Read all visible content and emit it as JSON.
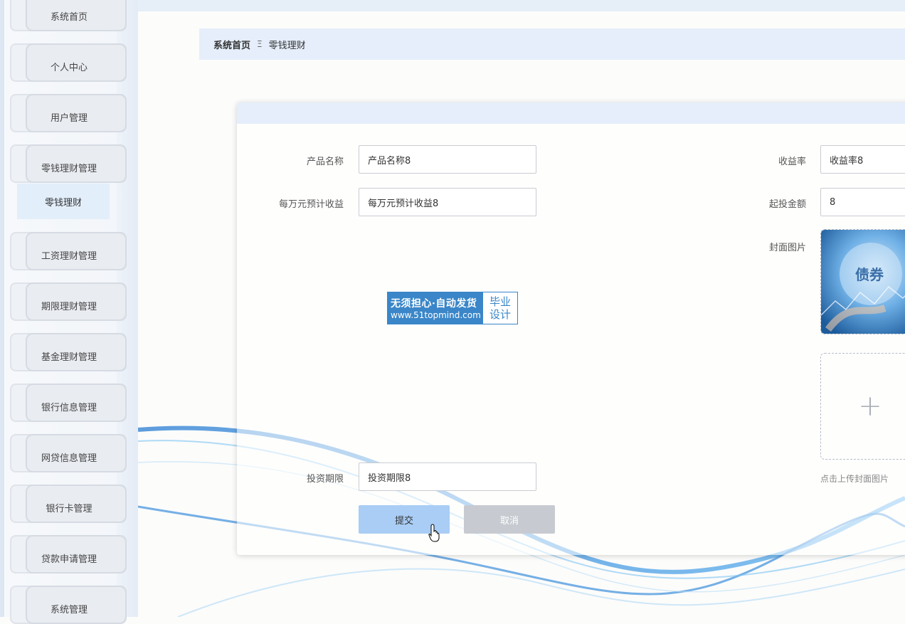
{
  "sidebar": {
    "items": [
      {
        "label": "系统首页"
      },
      {
        "label": "个人中心"
      },
      {
        "label": "用户管理"
      },
      {
        "label": "零钱理财管理"
      },
      {
        "label": "工资理财管理"
      },
      {
        "label": "期限理财管理"
      },
      {
        "label": "基金理财管理"
      },
      {
        "label": "银行信息管理"
      },
      {
        "label": "网贷信息管理"
      },
      {
        "label": "银行卡管理"
      },
      {
        "label": "贷款申请管理"
      },
      {
        "label": "系统管理"
      }
    ],
    "active_submenu": "零钱理财"
  },
  "breadcrumb": {
    "home": "系统首页",
    "separator": "Ξ",
    "current": "零钱理财"
  },
  "form": {
    "product_name": {
      "label": "产品名称",
      "value": "产品名称8"
    },
    "yield_per_10k": {
      "label": "每万元预计收益",
      "value": "每万元预计收益8"
    },
    "yield_rate": {
      "label": "收益率",
      "value": "收益率8"
    },
    "min_invest": {
      "label": "起投金额",
      "value": "8"
    },
    "cover": {
      "label": "封面图片",
      "image_text": "债券",
      "upload_hint": "点击上传封面图片",
      "upload_icon": "plus-icon"
    },
    "term": {
      "label": "投资期限",
      "value": "投资期限8"
    },
    "submit_label": "提交",
    "cancel_label": "取消"
  },
  "watermark": {
    "line1": "无须担心·自动发货",
    "line2": "www.51topmind.com",
    "right1": "毕业",
    "right2": "设计"
  },
  "colors": {
    "accent": "#a9cdf5",
    "header_bg": "#e5eefa",
    "watermark_blue": "#3a86c8"
  }
}
